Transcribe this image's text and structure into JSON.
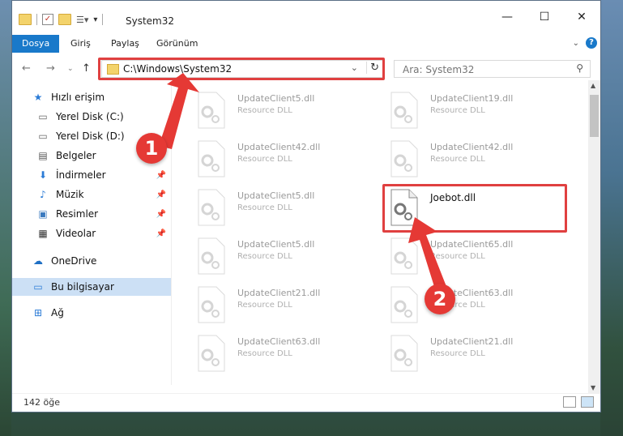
{
  "window": {
    "title": "System32"
  },
  "ribbon": {
    "tabs": [
      "Dosya",
      "Giriş",
      "Paylaş",
      "Görünüm"
    ]
  },
  "address": {
    "path": "C:\\Windows\\System32"
  },
  "search": {
    "placeholder": "Ara: System32"
  },
  "sidebar": {
    "items": [
      {
        "label": "Hızlı erişim",
        "icon": "star-icon"
      },
      {
        "label": "Yerel Disk (C:)",
        "icon": "drive-icon"
      },
      {
        "label": "Yerel Disk (D:)",
        "icon": "drive-icon"
      },
      {
        "label": "Belgeler",
        "icon": "document-icon"
      },
      {
        "label": "İndirmeler",
        "icon": "download-icon"
      },
      {
        "label": "Müzik",
        "icon": "music-icon"
      },
      {
        "label": "Resimler",
        "icon": "pictures-icon"
      },
      {
        "label": "Videolar",
        "icon": "video-icon"
      },
      {
        "label": "OneDrive",
        "icon": "cloud-icon"
      },
      {
        "label": "Bu bilgisayar",
        "icon": "computer-icon"
      },
      {
        "label": "Ağ",
        "icon": "network-icon"
      }
    ]
  },
  "files": [
    {
      "name": "UpdateClient5.dll",
      "type": "Resource DLL"
    },
    {
      "name": "UpdateClient19.dll",
      "type": "Resource DLL"
    },
    {
      "name": "UpdateClient42.dll",
      "type": "Resource DLL"
    },
    {
      "name": "UpdateClient42.dll",
      "type": "Resource DLL"
    },
    {
      "name": "UpdateClient5.dll",
      "type": "Resource DLL"
    },
    {
      "name": "Joebot.dll",
      "type": ""
    },
    {
      "name": "UpdateClient5.dll",
      "type": "Resource DLL"
    },
    {
      "name": "UpdateClient65.dll",
      "type": "Resource DLL"
    },
    {
      "name": "UpdateClient21.dll",
      "type": "Resource DLL"
    },
    {
      "name": "UpdateClient63.dll",
      "type": "Resource DLL"
    },
    {
      "name": "UpdateClient63.dll",
      "type": "Resource DLL"
    },
    {
      "name": "UpdateClient21.dll",
      "type": "Resource DLL"
    }
  ],
  "status": {
    "count": "142 öğe"
  },
  "annotations": {
    "badge1": "1",
    "badge2": "2",
    "color": "#e53935"
  }
}
